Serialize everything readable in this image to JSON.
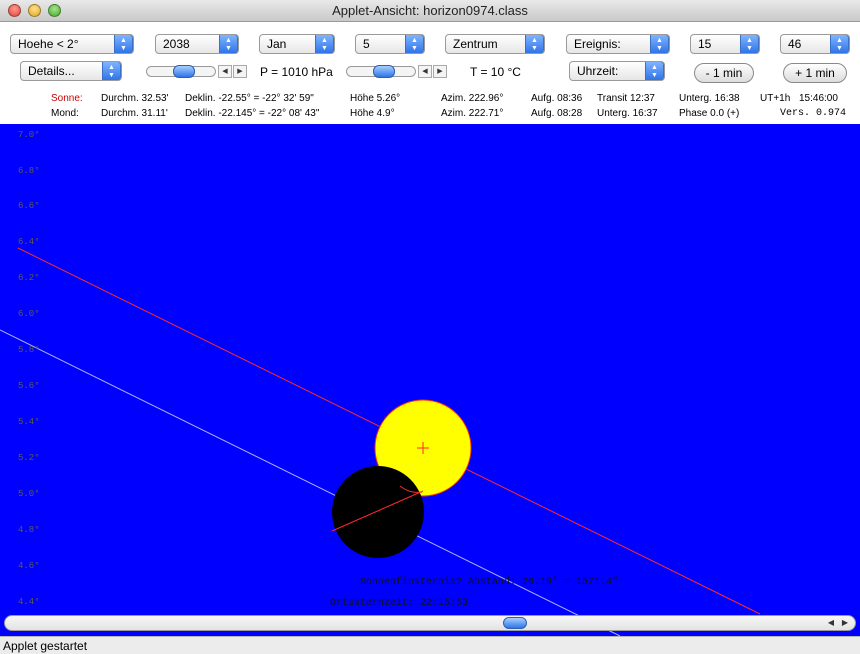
{
  "window": {
    "title": "Applet-Ansicht: horizon0974.class"
  },
  "toolbar": {
    "altitude_select": "Hoehe < 2°",
    "year_select": "2038",
    "month_select": "Jan",
    "day_select": "5",
    "center_select": "Zentrum",
    "event_select": "Ereignis:",
    "hour_select": "15",
    "minute_select": "46",
    "details_select": "Details...",
    "pressure_label": "P = 1010 hPa",
    "temperature_label": "T = 10 °C",
    "time_select": "Uhrzeit:",
    "minus_min_label": "- 1 min",
    "plus_min_label": "+ 1 min"
  },
  "info": {
    "sun": {
      "name": "Sonne:",
      "diameter": "Durchm. 32.53'",
      "declination": "Deklin. -22.55° = -22° 32' 59\"",
      "altitude": "Höhe 5.26°",
      "azimuth": "Azim. 222.96°",
      "rise": "Aufg. 08:36",
      "transit": "Transit 12:37",
      "set": "Unterg. 16:38",
      "ut": "UT+1h",
      "time": "15:46:00"
    },
    "moon": {
      "name": "Mond:",
      "diameter": "Durchm. 31.11'",
      "declination": "Deklin. -22.145° = -22° 08' 43\"",
      "altitude": "Höhe 4.9°",
      "azimuth": "Azim. 222.71°",
      "rise": "Aufg. 08:28",
      "set": "Unterg. 16:37",
      "phase": "Phase 0.0 (+)",
      "version": "Vers. 0.974"
    }
  },
  "canvas": {
    "y_labels": [
      "7.0°",
      "6.8°",
      "6.6°",
      "6.4°",
      "6.2°",
      "6.0°",
      "5.8°",
      "5.6°",
      "5.4°",
      "5.2°",
      "5.0°",
      "4.8°",
      "4.6°",
      "4.4°"
    ],
    "eclipse_text": "Sonnenfinsternis? Abstand: 26.19' = 1571.4\"",
    "sidereal_text": "Ortssternzeit: 22:15:53",
    "colors": {
      "sky": "#0000ff",
      "sun": "#ffff00",
      "moon": "#000000",
      "sun_path": "#ff0000",
      "moon_path": "#aaaaff"
    }
  },
  "status": {
    "text": "Applet gestartet"
  }
}
